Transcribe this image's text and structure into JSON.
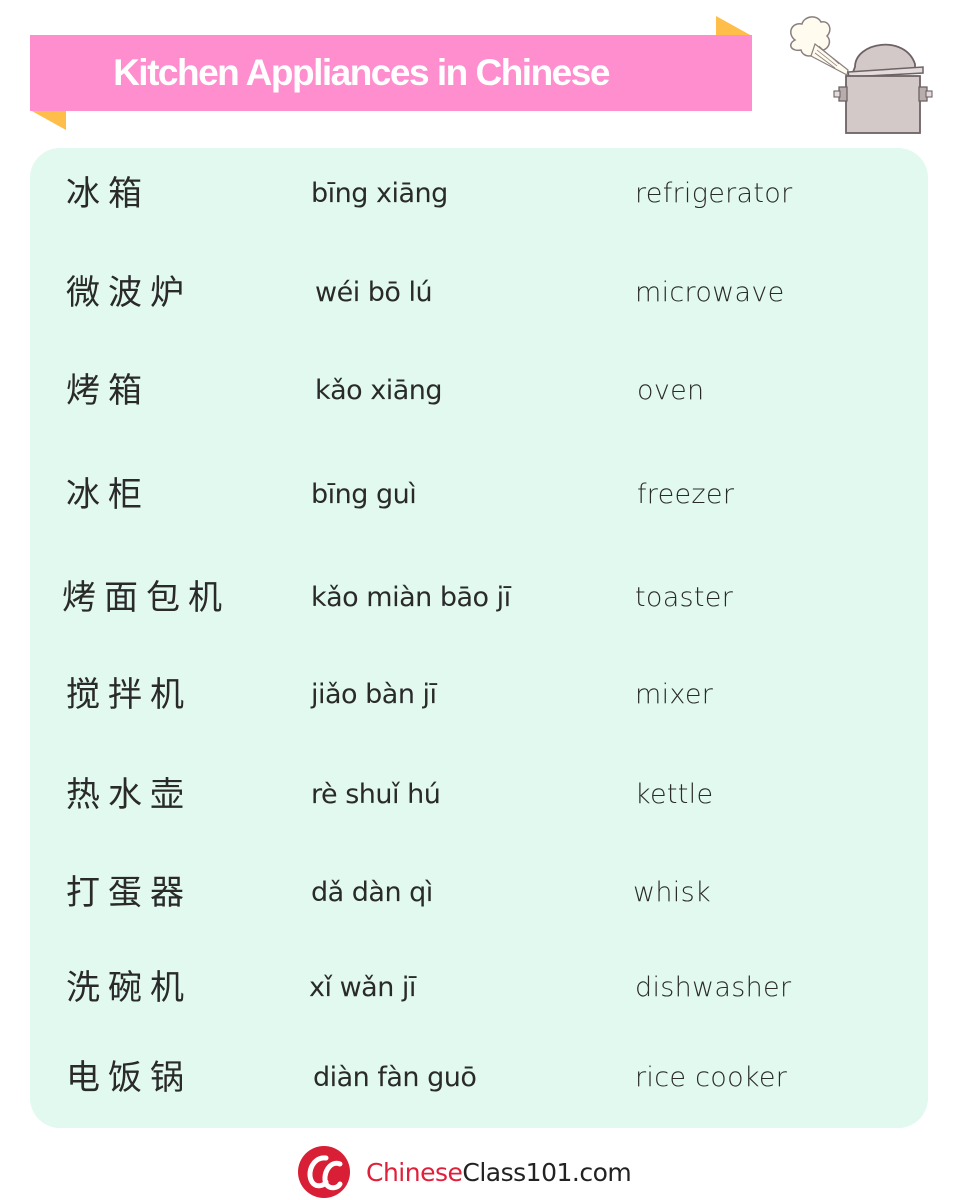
{
  "header": {
    "title": "Kitchen Appliances in Chinese",
    "banner_color": "#ff8ecf",
    "fold_color": "#ffbd4a",
    "illustration": "steaming-pot-icon"
  },
  "panel": {
    "background": "#e1f9ee",
    "rows": [
      {
        "hanzi": "冰箱",
        "pinyin": "bīng xiāng",
        "english": "refrigerator"
      },
      {
        "hanzi": "微波炉",
        "pinyin": "wéi bō lú",
        "english": "microwave"
      },
      {
        "hanzi": "烤箱",
        "pinyin": "kǎo xiāng",
        "english": "oven"
      },
      {
        "hanzi": "冰柜",
        "pinyin": "bīng guì",
        "english": "freezer"
      },
      {
        "hanzi": "烤面包机",
        "pinyin": "kǎo miàn bāo jī",
        "english": "toaster"
      },
      {
        "hanzi": "搅拌机",
        "pinyin": "jiǎo bàn jī",
        "english": "mixer"
      },
      {
        "hanzi": "热水壶",
        "pinyin": "rè shuǐ hú",
        "english": "kettle"
      },
      {
        "hanzi": "打蛋器",
        "pinyin": "dǎ dàn qì",
        "english": "whisk"
      },
      {
        "hanzi": "洗碗机",
        "pinyin": "xǐ wǎn jī",
        "english": "dishwasher"
      },
      {
        "hanzi": "电饭锅",
        "pinyin": "diàn fàn guō",
        "english": "rice cooker"
      }
    ]
  },
  "footer": {
    "logo": "chineseclass101-logo-icon",
    "brand_part1": "Chinese",
    "brand_part2": "Class101.com",
    "brand_color": "#e0203a"
  }
}
